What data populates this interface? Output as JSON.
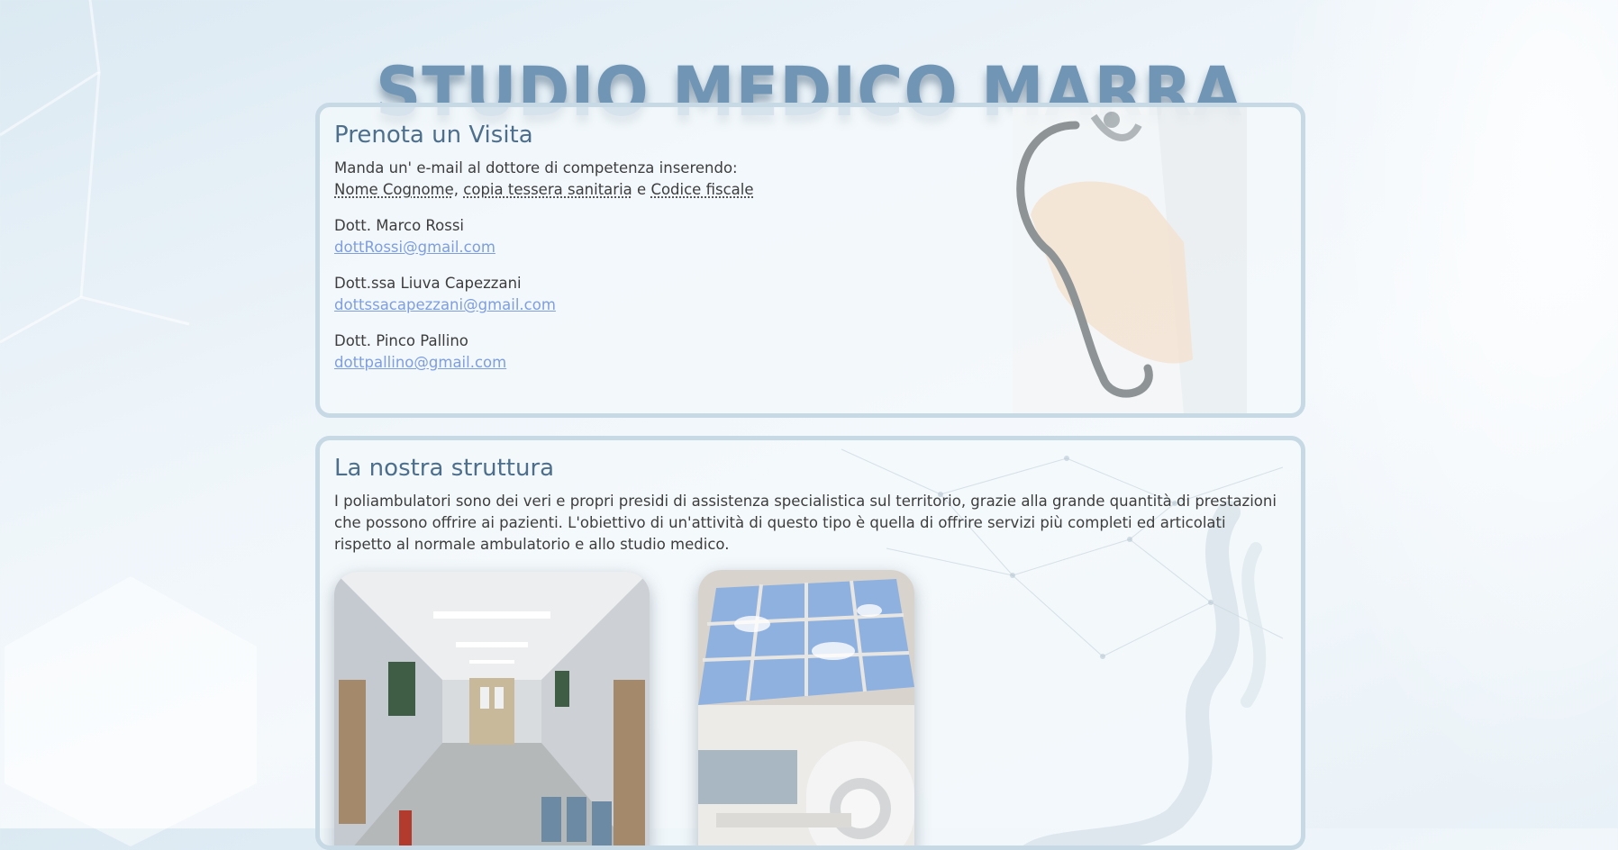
{
  "site": {
    "title": "STUDIO MEDICO MARRA"
  },
  "booking": {
    "heading": "Prenota un Visita",
    "intro": "Manda un' e-mail al dottore di competenza inserendo:",
    "requirements": {
      "item1": "Nome Cognome",
      "sep1": ", ",
      "item2": "copia tessera sanitaria",
      "sep2": " e ",
      "item3": "Codice fiscale"
    },
    "doctors": [
      {
        "name": "Dott. Marco Rossi",
        "email": "dottRossi@gmail.com"
      },
      {
        "name": "Dott.ssa Liuva Capezzani",
        "email": "dottssacapezzani@gmail.com"
      },
      {
        "name": "Dott. Pinco Pallino",
        "email": "dottpallino@gmail.com"
      }
    ]
  },
  "structure": {
    "heading": "La nostra struttura",
    "description": "I poliambulatori sono dei veri e propri presidi di assistenza specialistica sul territorio, grazie alla grande quantità di prestazioni che possono offrire ai pazienti. L'obiettivo di un'attività di questo tipo è quella di offrire servizi più completi ed articolati rispetto al normale ambulatorio e allo studio medico."
  },
  "colors": {
    "title": "#7196b5",
    "heading": "#4d6f8c",
    "link": "#7e9ee0",
    "card_border": "#c6d9e4"
  },
  "icons": {
    "doctor_illustration": "doctor-stethoscope-illustration",
    "hallway_photo": "hospital-hallway-photo",
    "mri_photo": "mri-room-photo"
  }
}
